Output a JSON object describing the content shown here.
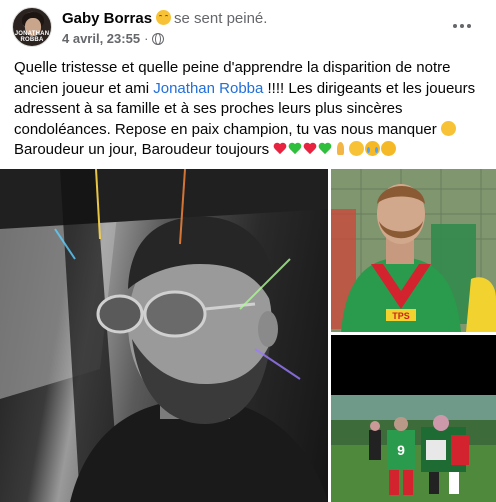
{
  "post": {
    "author": "Gaby Borras",
    "feeling": "se sent peiné.",
    "timestamp": "4 avril, 23:55",
    "separator": "·",
    "avatar_text": "JONATHAN ROBBA",
    "text_before_mention": "Quelle tristesse et quelle peine d'apprendre la disparition de notre ancien joueur et ami ",
    "mention": "Jonathan Robba",
    "text_after_mention": " !!!! Les dirigeants et les joueurs adressent à sa famille et à ses proches leurs plus sincères condoléances. Repose en paix champion, tu vas nous manquer ",
    "closing_line": "Baroudeur un jour, Baroudeur toujours "
  },
  "icons": {
    "avatar": "profile-avatar",
    "feeling": "sad-face-emoji",
    "privacy": "globe-icon",
    "more": "more-options-icon"
  },
  "colors": {
    "link": "#216fdb",
    "meta": "#65676b",
    "text": "#050505"
  },
  "photos": {
    "main": {
      "jersey_text": ""
    },
    "side_top": {
      "sponsor": "TPS"
    },
    "side_bottom": {
      "jersey_number": "9"
    }
  }
}
